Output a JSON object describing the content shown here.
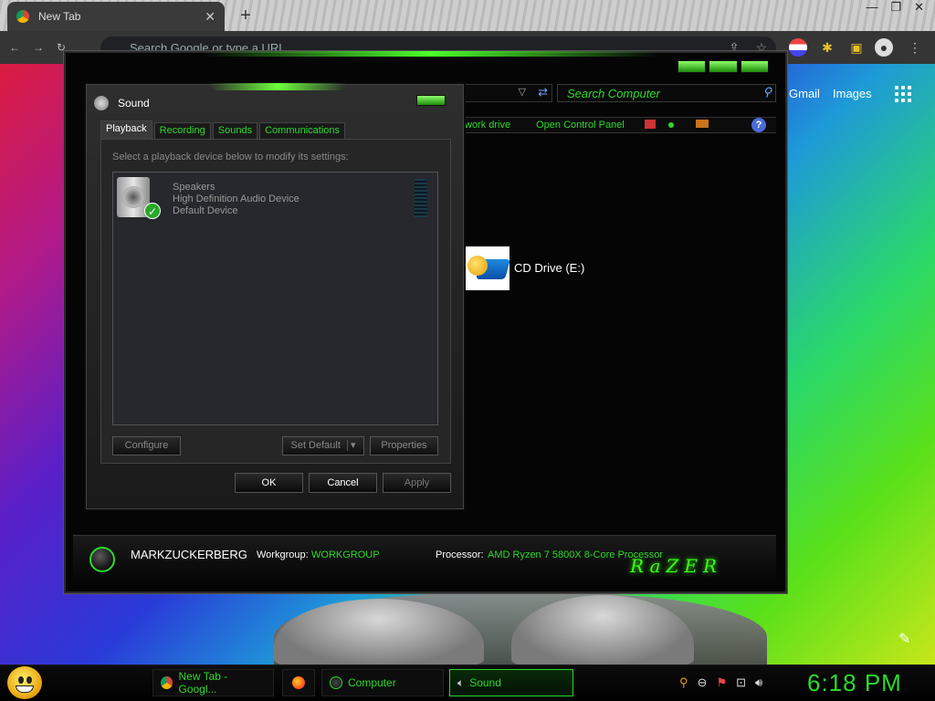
{
  "browser": {
    "tab_title": "New Tab",
    "tab_close": "✕",
    "new_tab": "+",
    "window_controls": [
      "—",
      "❐",
      "✕"
    ],
    "omnibox_placeholder": "Search Google or type a URL",
    "links": {
      "gmail": "Gmail",
      "images": "Images"
    }
  },
  "computer_window": {
    "search_placeholder": "Search Computer",
    "command_bar": [
      "work drive",
      "Open Control Panel"
    ],
    "help": "?",
    "drive_label": "CD Drive (E:)",
    "status": {
      "pc_name": "MARKZUCKERBERG",
      "workgroup_label": "Workgroup:",
      "workgroup_value": "WORKGROUP",
      "processor_label": "Processor:",
      "processor_value": "AMD Ryzen 7 5800X 8-Core Processor"
    },
    "brand": "RaZER"
  },
  "sound_dialog": {
    "title": "Sound",
    "tabs": [
      "Playback",
      "Recording",
      "Sounds",
      "Communications"
    ],
    "active_tab": "Playback",
    "hint": "Select a playback device below to modify its settings:",
    "device": {
      "name": "Speakers",
      "description": "High Definition Audio Device",
      "status": "Default Device"
    },
    "buttons": {
      "configure": "Configure",
      "set_default": "Set Default",
      "properties": "Properties",
      "ok": "OK",
      "cancel": "Cancel",
      "apply": "Apply"
    }
  },
  "taskbar": {
    "items": [
      {
        "label": "New Tab - Googl...",
        "icon": "chrome-icon"
      },
      {
        "label": "",
        "icon": "firefox-icon"
      },
      {
        "label": "Computer",
        "icon": "computer-icon"
      },
      {
        "label": "Sound",
        "icon": "speaker-icon",
        "active": true
      }
    ],
    "clock": "6:18 PM"
  },
  "colors": {
    "accent": "#2bd92b",
    "brand_glow": "#39ff14"
  }
}
